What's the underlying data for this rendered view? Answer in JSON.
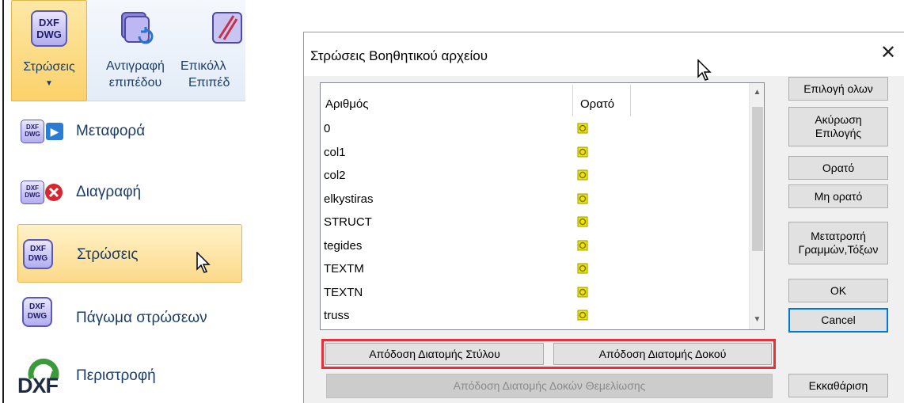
{
  "ribbon": {
    "buttons": [
      {
        "icon_text_1": "DXF",
        "icon_text_2": "DWG",
        "label_line1": "Στρώσεις",
        "caret": "▼"
      },
      {
        "label_line1": "Αντιγραφή",
        "label_line2": "επιπέδου"
      },
      {
        "label_line1": "Επικόλλ",
        "label_line2": "Επιπέδ"
      }
    ]
  },
  "menu": {
    "items": [
      {
        "label": "Μεταφορά",
        "icon": "dxf-transfer-icon"
      },
      {
        "label": "Διαγραφή",
        "icon": "dxf-delete-icon"
      },
      {
        "label": "Στρώσεις",
        "icon": "dxf-layers-icon"
      },
      {
        "label": "Πάγωμα στρώσεων",
        "icon": "dxf-freeze-icon"
      },
      {
        "label": "Περιστροφή",
        "icon": "dxf-rotate-icon"
      }
    ],
    "icon_text_1": "DXF",
    "icon_text_2": "DWG",
    "rotate_icon_text": "DXF"
  },
  "dialog": {
    "title": "Στρώσεις Βοηθητικού αρχείου",
    "close": "✕",
    "columns": {
      "number": "Αριθμός",
      "visible": "Ορατό"
    },
    "rows": [
      {
        "name": "0"
      },
      {
        "name": "col1"
      },
      {
        "name": "col2"
      },
      {
        "name": "elkystiras"
      },
      {
        "name": "STRUCT"
      },
      {
        "name": "tegides"
      },
      {
        "name": "TEXTM"
      },
      {
        "name": "TEXTN"
      },
      {
        "name": "truss"
      }
    ],
    "scroll_up": "▲",
    "scroll_down": "▼",
    "buttons": {
      "select_all": "Επιλογή ολων",
      "cancel_selection_1": "Ακύρωση",
      "cancel_selection_2": "Επιλογής",
      "visible": "Ορατό",
      "not_visible": "Μη ορατό",
      "convert_1": "Μετατροπή",
      "convert_2": "Γραμμών,Τόξων",
      "ok": "OK",
      "cancel": "Cancel",
      "clear": "Εκκαθάριση",
      "assign_column": "Απόδοση Διατομής Στύλου",
      "assign_beam": "Απόδοση Διατομής Δοκού",
      "assign_foundation": "Απόδοση Διατομής Δοκών Θεμελίωσης"
    }
  },
  "colors": {
    "accent": "#0078d7",
    "highlight": "#e8303a",
    "active_bg": "#fcd98a",
    "visible_icon": "#f2e600"
  }
}
